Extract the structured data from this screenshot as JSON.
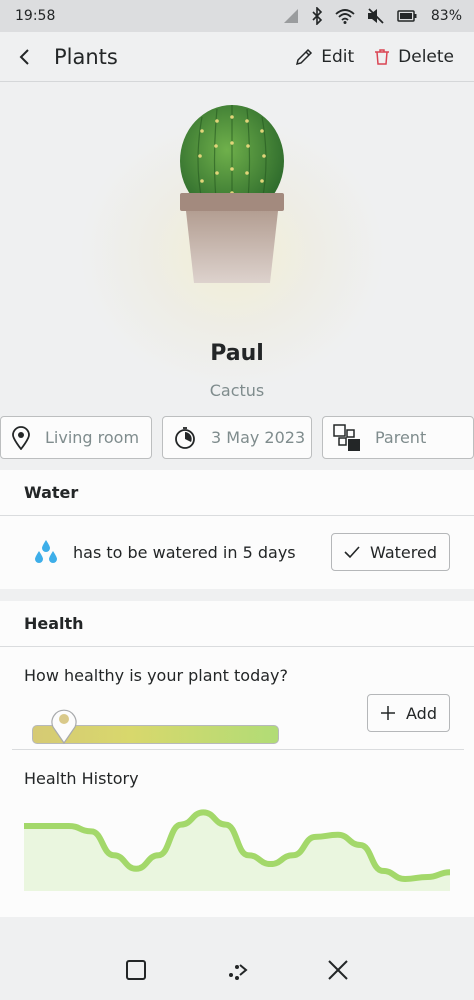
{
  "status_bar": {
    "time": "19:58",
    "battery_percent": "83%",
    "icons": [
      "signal-icon",
      "bluetooth-icon",
      "wifi-icon",
      "mute-icon",
      "battery-icon"
    ]
  },
  "header": {
    "title": "Plants",
    "edit_label": "Edit",
    "delete_label": "Delete"
  },
  "plant": {
    "name": "Paul",
    "species": "Cactus"
  },
  "chips": {
    "location": "Living room",
    "date": "3 May 2023",
    "parent": "Parent"
  },
  "water": {
    "heading": "Water",
    "message": "has to be watered in 5 days",
    "button_label": "Watered"
  },
  "health": {
    "heading": "Health",
    "question": "How healthy is your plant today?",
    "slider_level": 0.13,
    "add_label": "Add",
    "history_label": "Health History",
    "history_values": [
      0.78,
      0.78,
      0.78,
      0.7,
      0.35,
      0.15,
      0.35,
      0.8,
      0.98,
      0.8,
      0.35,
      0.22,
      0.35,
      0.62,
      0.65,
      0.5,
      0.12,
      0.0,
      0.03,
      0.1
    ],
    "accent": "#a3d86a"
  },
  "colors": {
    "background": "#eff0f1",
    "card": "#fcfcfc",
    "delete_icon": "#da4453",
    "secondary_text": "#7f8c8d"
  }
}
